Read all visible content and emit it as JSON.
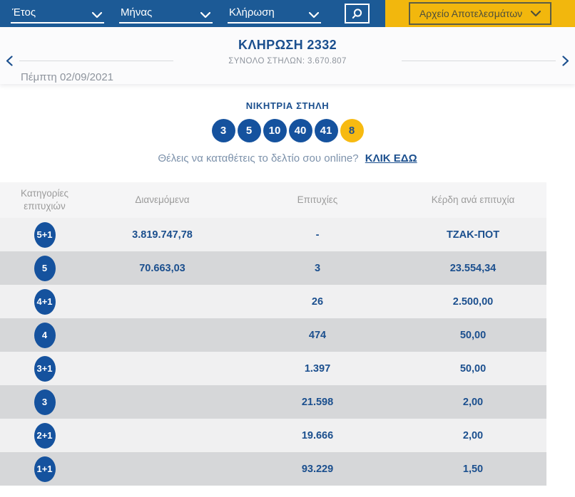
{
  "filter_bar": {
    "dropdowns": [
      {
        "label": "Έτος"
      },
      {
        "label": "Μήνας"
      },
      {
        "label": "Κλήρωση"
      }
    ],
    "archive_button_label": "Αρχείο Αποτελεσμάτων",
    "icons": {
      "search": "magnifier",
      "dropdown": "chevron-down"
    }
  },
  "draw_header": {
    "date": "Πέμπτη 02/09/2021",
    "title": "ΚΛΗΡΩΣΗ 2332",
    "total_columns": "ΣΥΝΟΛΟ ΣΤΗΛΩΝ: 3.670.807",
    "prev_icon": "chevron-left",
    "next_icon": "chevron-right"
  },
  "winning": {
    "heading": "ΝΙΚΗΤΡΙΑ ΣΤΗΛΗ",
    "numbers": [
      "3",
      "5",
      "10",
      "40",
      "41"
    ],
    "joker": "8"
  },
  "online_cta": {
    "text": "Θέλεις να καταθέτεις το δελτίο σου online?",
    "link_label": "ΚΛΙΚ ΕΔΩ"
  },
  "table": {
    "headers": [
      "Κατηγορίες επιτυχιών",
      "Διανεμόμενα",
      "Επιτυχίες",
      "Κέρδη ανά επιτυχία"
    ],
    "rows": [
      {
        "category": "5+1",
        "distributed": "3.819.747,78",
        "winners": "-",
        "prize": "ΤΖΑΚ-ΠΟΤ"
      },
      {
        "category": "5",
        "distributed": "70.663,03",
        "winners": "3",
        "prize": "23.554,34"
      },
      {
        "category": "4+1",
        "distributed": "",
        "winners": "26",
        "prize": "2.500,00"
      },
      {
        "category": "4",
        "distributed": "",
        "winners": "474",
        "prize": "50,00"
      },
      {
        "category": "3+1",
        "distributed": "",
        "winners": "1.397",
        "prize": "50,00"
      },
      {
        "category": "3",
        "distributed": "",
        "winners": "21.598",
        "prize": "2,00"
      },
      {
        "category": "2+1",
        "distributed": "",
        "winners": "19.666",
        "prize": "2,00"
      },
      {
        "category": "1+1",
        "distributed": "",
        "winners": "93.229",
        "prize": "1,50"
      }
    ]
  },
  "colors": {
    "bar_blue": "#1c5a96",
    "accent_blue": "#15529e",
    "text_blue": "#1b4f8e",
    "brand_yellow": "#f2b70d",
    "row_light": "#f0f0f1",
    "row_dark": "#d6d7d9"
  }
}
